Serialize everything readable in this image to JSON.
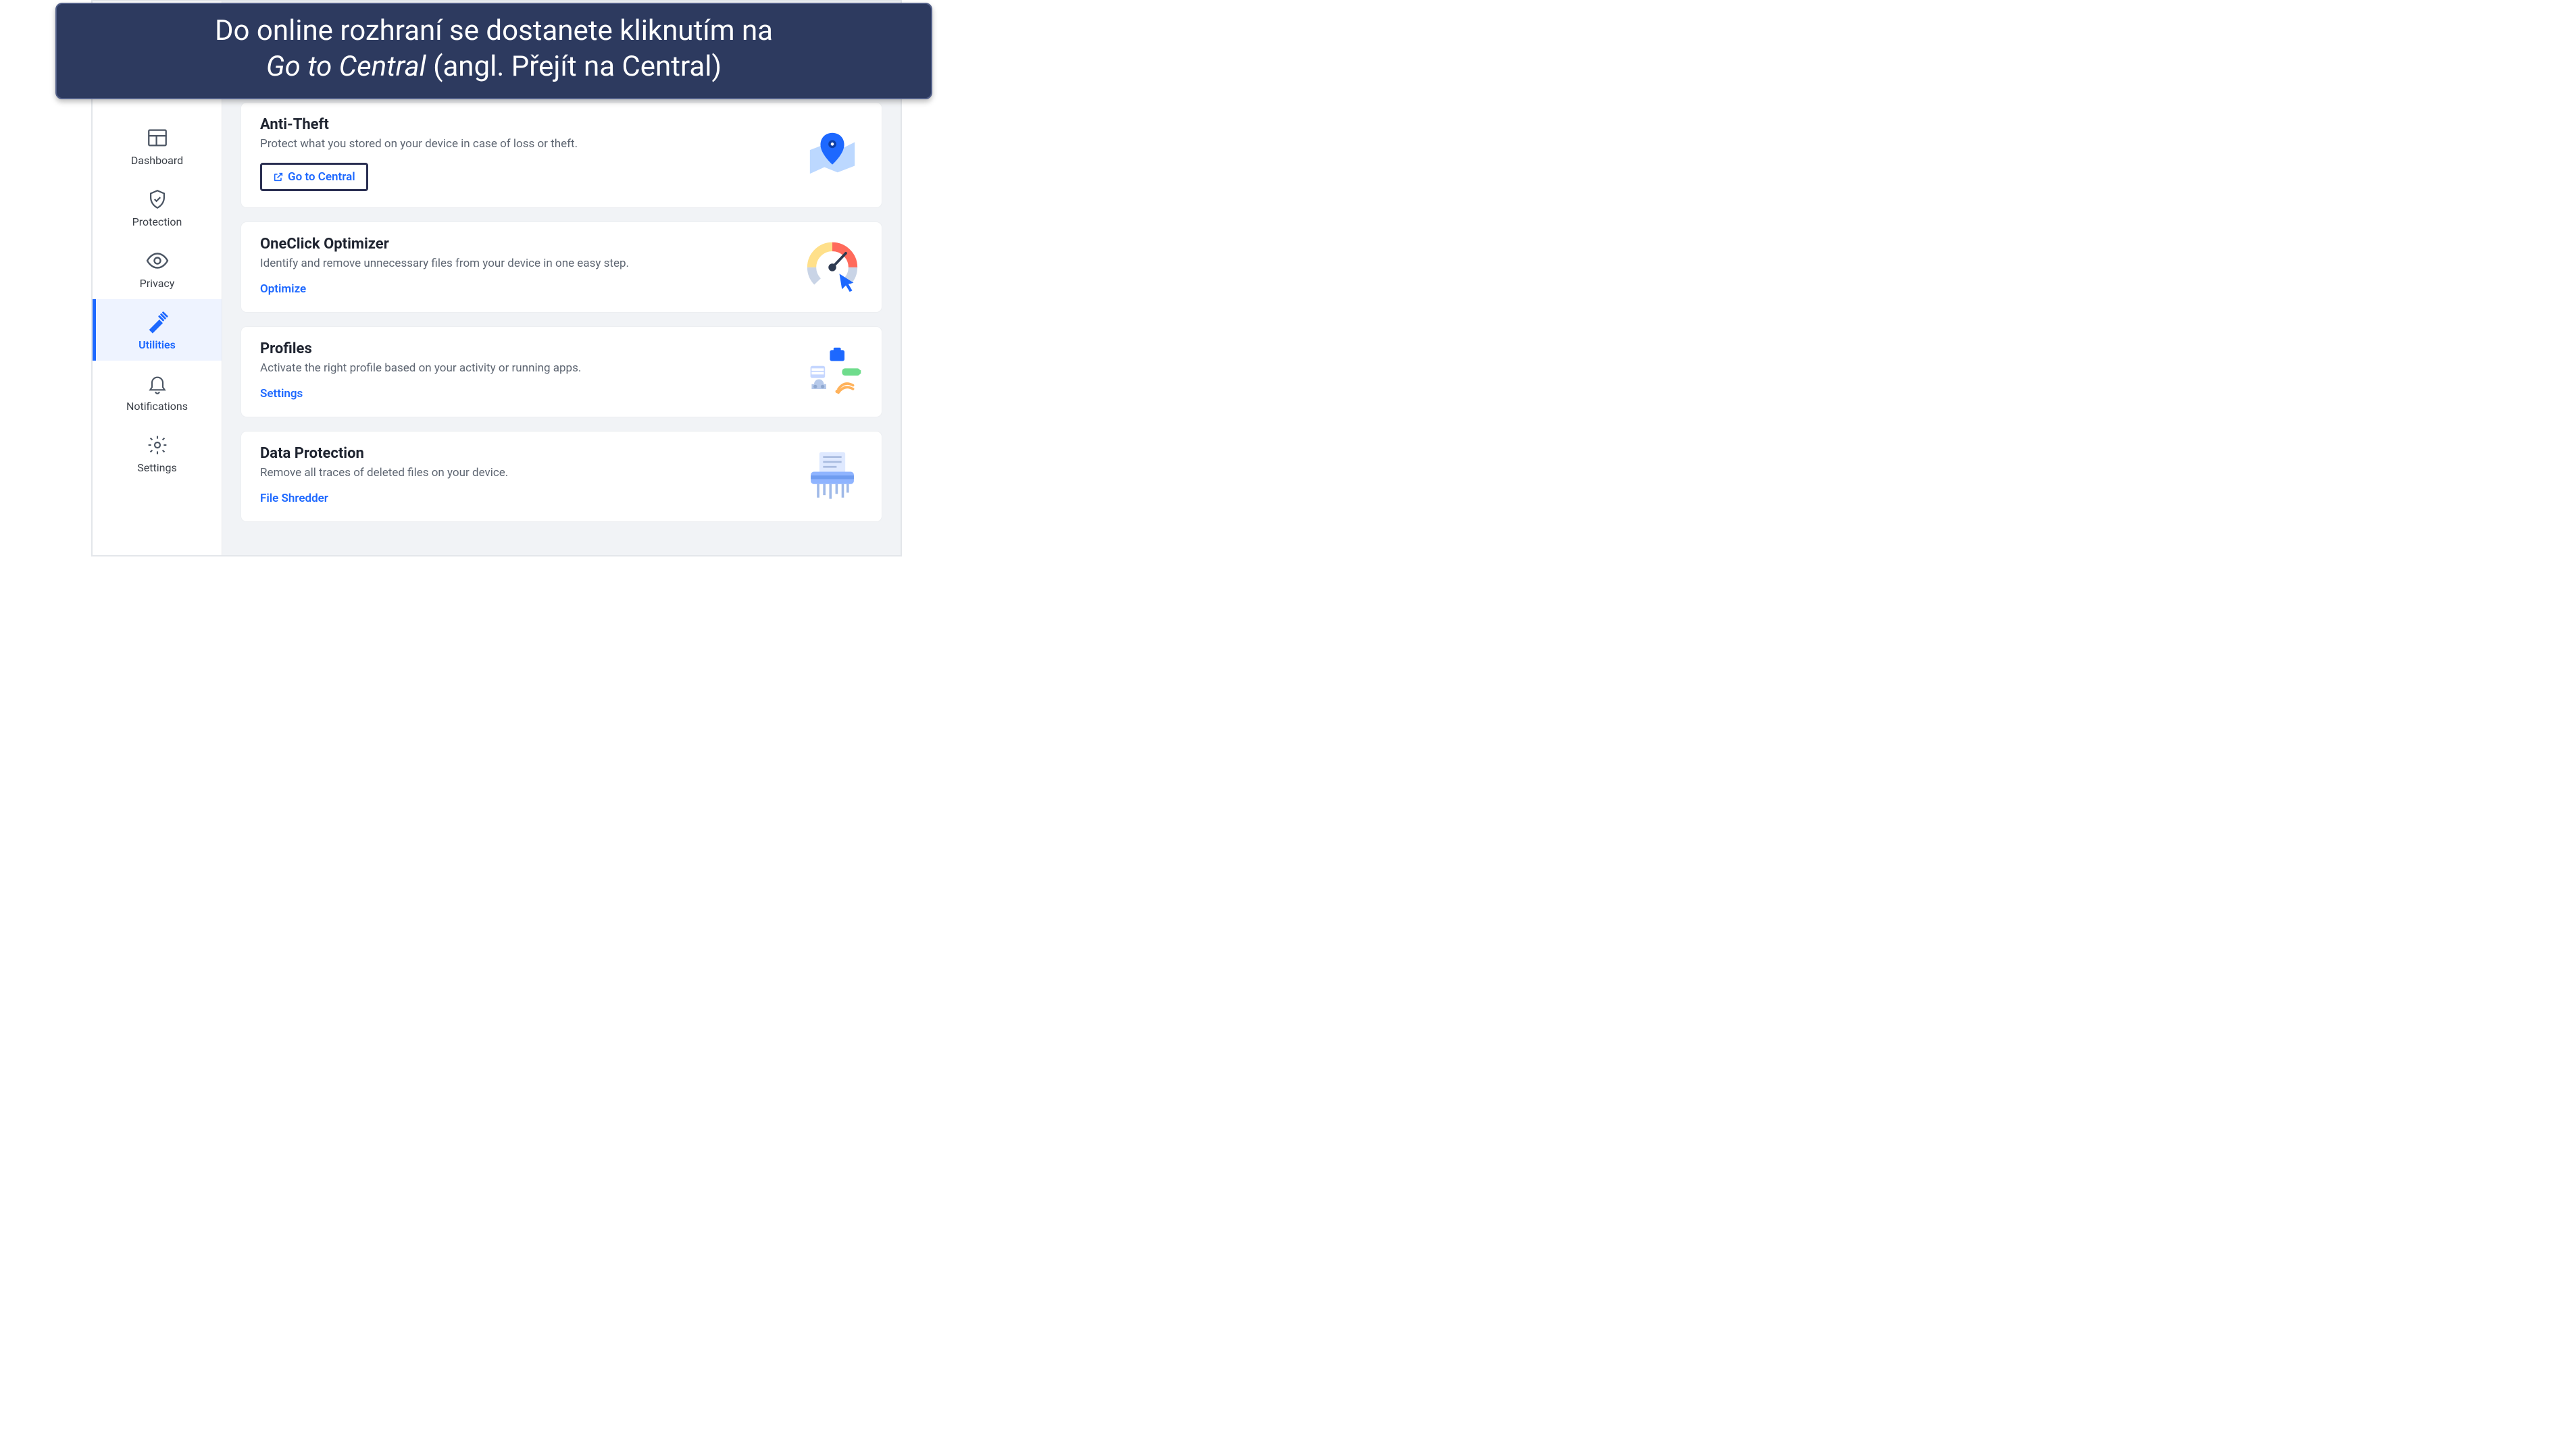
{
  "banner": {
    "line1": "Do online rozhraní se dostanete kliknutím na",
    "emphasis": "Go to Central",
    "line2_suffix": " (angl. Přejít na Central)"
  },
  "sidebar": {
    "items": [
      {
        "label": "Dashboard"
      },
      {
        "label": "Protection"
      },
      {
        "label": "Privacy"
      },
      {
        "label": "Utilities"
      },
      {
        "label": "Notifications"
      },
      {
        "label": "Settings"
      }
    ],
    "active_index": 3
  },
  "cards": [
    {
      "title": "Anti-Theft",
      "desc": "Protect what you stored on your device in case of loss or theft.",
      "action": "Go to Central",
      "action_has_icon": true,
      "action_boxed": true
    },
    {
      "title": "OneClick Optimizer",
      "desc": "Identify and remove unnecessary files from your device in one easy step.",
      "action": "Optimize"
    },
    {
      "title": "Profiles",
      "desc": "Activate the right profile based on your activity or running apps.",
      "action": "Settings"
    },
    {
      "title": "Data Protection",
      "desc": "Remove all traces of deleted files on your device.",
      "action": "File Shredder"
    }
  ]
}
